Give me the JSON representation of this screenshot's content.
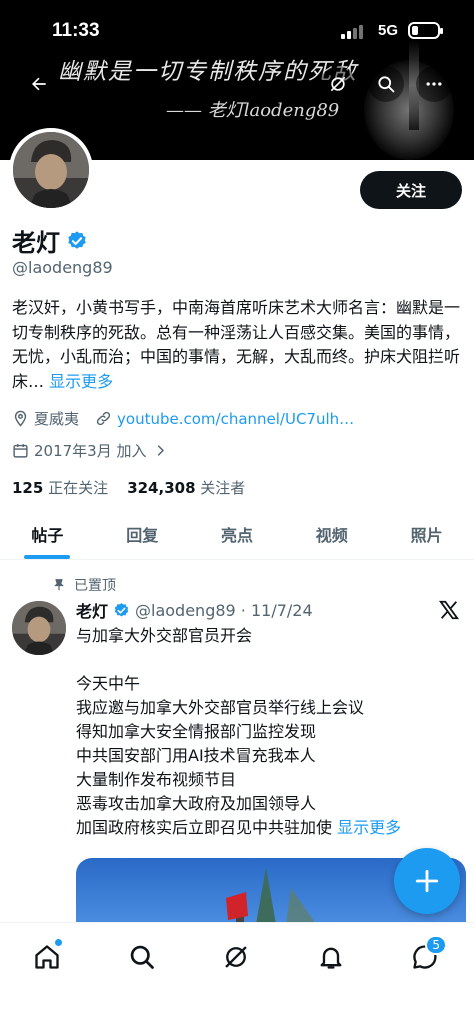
{
  "status_bar": {
    "time": "11:33",
    "network": "5G"
  },
  "banner": {
    "line1": "幽默是一切专制秩序的死敌",
    "line2": "—— 老灯laodeng89"
  },
  "profile": {
    "name": "老灯",
    "handle": "@laodeng89",
    "follow_label": "关注",
    "bio": "老汉奸，小黄书写手，中南海首席听床艺术大师名言：幽默是一切专制秩序的死敌。总有一种淫荡让人百感交集。美国的事情，无忧，小乱而治；中国的事情，无解，大乱而终。护床犬阻拦听床…",
    "bio_show_more": "显示更多",
    "location": "夏威夷",
    "website": "youtube.com/channel/UC7ulh…",
    "joined": "2017年3月 加入",
    "following_count": "125",
    "following_label": "正在关注",
    "followers_count": "324,308",
    "followers_label": "关注者"
  },
  "tabs": [
    {
      "label": "帖子",
      "active": true
    },
    {
      "label": "回复",
      "active": false
    },
    {
      "label": "亮点",
      "active": false
    },
    {
      "label": "视频",
      "active": false
    },
    {
      "label": "照片",
      "active": false
    }
  ],
  "post": {
    "pinned_label": "已置顶",
    "author": "老灯",
    "meta": "@laodeng89 · 11/7/24",
    "lines": [
      "与加拿大外交部官员开会",
      "",
      "今天中午",
      "我应邀与加拿大外交部官员举行线上会议",
      "得知加拿大安全情报部门监控发现",
      "中共国安部门用AI技术冒充我本人",
      "大量制作发布视频节目",
      "恶毒攻击加拿大政府及加国领导人",
      "加国政府核实后立即召见中共驻加使"
    ],
    "show_more": "显示更多"
  },
  "bottom_nav": {
    "messages_badge": "5"
  },
  "colors": {
    "accent": "#1d9bf0",
    "text": "#0f1419",
    "secondary": "#536471"
  }
}
